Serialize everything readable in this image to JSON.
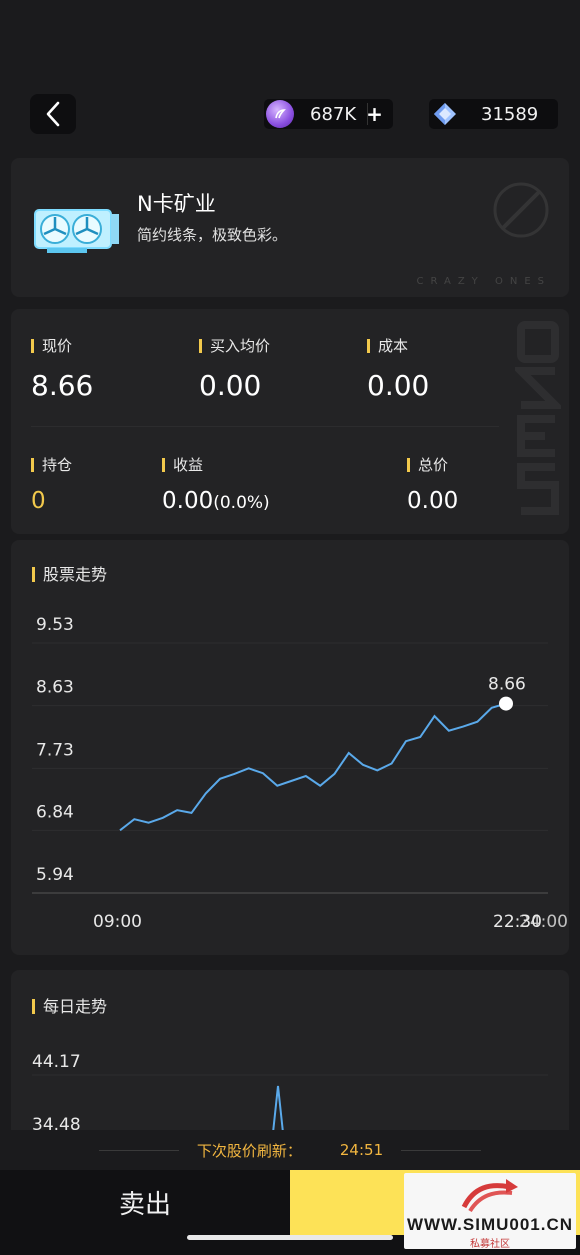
{
  "header": {
    "coins": "687K",
    "coins_plus": "+",
    "gems": "31589"
  },
  "product": {
    "title": "N卡矿业",
    "subtitle": "简约线条，极致色彩。",
    "brand_word": "CRAZY ONES"
  },
  "stats": {
    "current_price": {
      "label": "现价",
      "value": "8.66"
    },
    "avg_buy_price": {
      "label": "买入均价",
      "value": "0.00"
    },
    "cost": {
      "label": "成本",
      "value": "0.00"
    },
    "holdings": {
      "label": "持仓",
      "value": "0"
    },
    "profit": {
      "label": "收益",
      "value": "0.00",
      "percent": "(0.0%)"
    },
    "total": {
      "label": "总价",
      "value": "0.00"
    }
  },
  "stock_trend": {
    "title": "股票走势"
  },
  "daily_trend": {
    "title": "每日走势"
  },
  "refresh": {
    "label": "下次股价刷新：",
    "countdown": "24:51"
  },
  "actions": {
    "sell_label": "卖出"
  },
  "watermark": {
    "site": "WWW.SIMU001.CN",
    "tagline": "私募社区"
  },
  "colors": {
    "accent_yellow": "#f2c94c",
    "line_blue": "#5aa9ea",
    "buy_button": "#fde257"
  },
  "chart_data": [
    {
      "type": "line",
      "title": "股票走势",
      "ytick_labels": [
        "9.53",
        "8.63",
        "7.73",
        "6.84",
        "5.94"
      ],
      "yticks": [
        9.53,
        8.63,
        7.73,
        6.84,
        5.94
      ],
      "ylim": [
        5.94,
        9.53
      ],
      "xtick_labels": [
        "09:00",
        "22:30",
        "24:00"
      ],
      "last_value_label": "8.66",
      "series": [
        {
          "values": [
            6.84,
            7.0,
            6.95,
            7.02,
            7.13,
            7.09,
            7.37,
            7.58,
            7.65,
            7.73,
            7.66,
            7.48,
            7.55,
            7.62,
            7.48,
            7.65,
            7.95,
            7.78,
            7.7,
            7.8,
            8.12,
            8.18,
            8.48,
            8.27,
            8.33,
            8.4,
            8.6,
            8.66
          ]
        }
      ],
      "grid": true
    },
    {
      "type": "line",
      "title": "每日走势",
      "ytick_labels": [
        "44.17",
        "34.48"
      ],
      "yticks": [
        44.17,
        34.48
      ],
      "grid": true
    }
  ]
}
